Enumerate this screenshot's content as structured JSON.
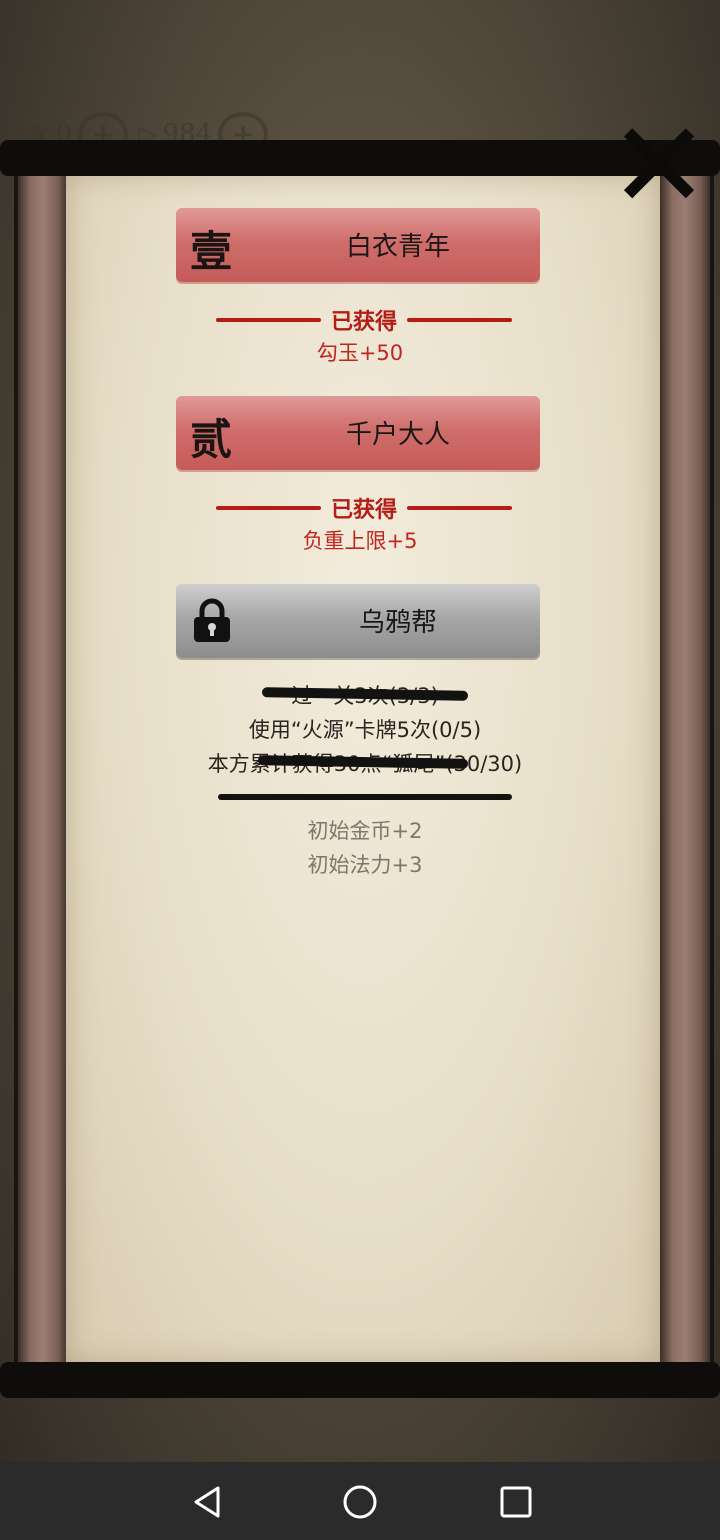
{
  "topbar": {
    "currency1_value": "0",
    "currency2_value": "984",
    "plus_label": "+"
  },
  "close_button": {
    "label": "✕"
  },
  "tiers": [
    {
      "number": "壹",
      "title": "白衣青年",
      "status": "已获得",
      "reward": "勾玉+50",
      "unlocked": true
    },
    {
      "number": "贰",
      "title": "千户大人",
      "status": "已获得",
      "reward": "负重上限+5",
      "unlocked": true
    },
    {
      "title": "乌鸦帮",
      "unlocked": false,
      "tasks": [
        {
          "text": "过一关3次(3/3)",
          "completed": true
        },
        {
          "text": "使用“火源”卡牌5次(0/5)",
          "completed": false
        },
        {
          "text": "本方累计获得30点“狐尾”(30/30)",
          "completed": true
        }
      ],
      "bonuses": [
        "初始金币+2",
        "初始法力+3"
      ]
    }
  ],
  "colors": {
    "reward_red": "#c0261f",
    "banner_red": "#cf6e6b",
    "banner_gray": "#a7a7a7",
    "muted_text": "#7d776d"
  },
  "icons": {
    "lock": "lock-icon",
    "close": "close-icon",
    "back": "back-triangle-icon",
    "home": "home-circle-icon",
    "recent": "recent-square-icon"
  }
}
